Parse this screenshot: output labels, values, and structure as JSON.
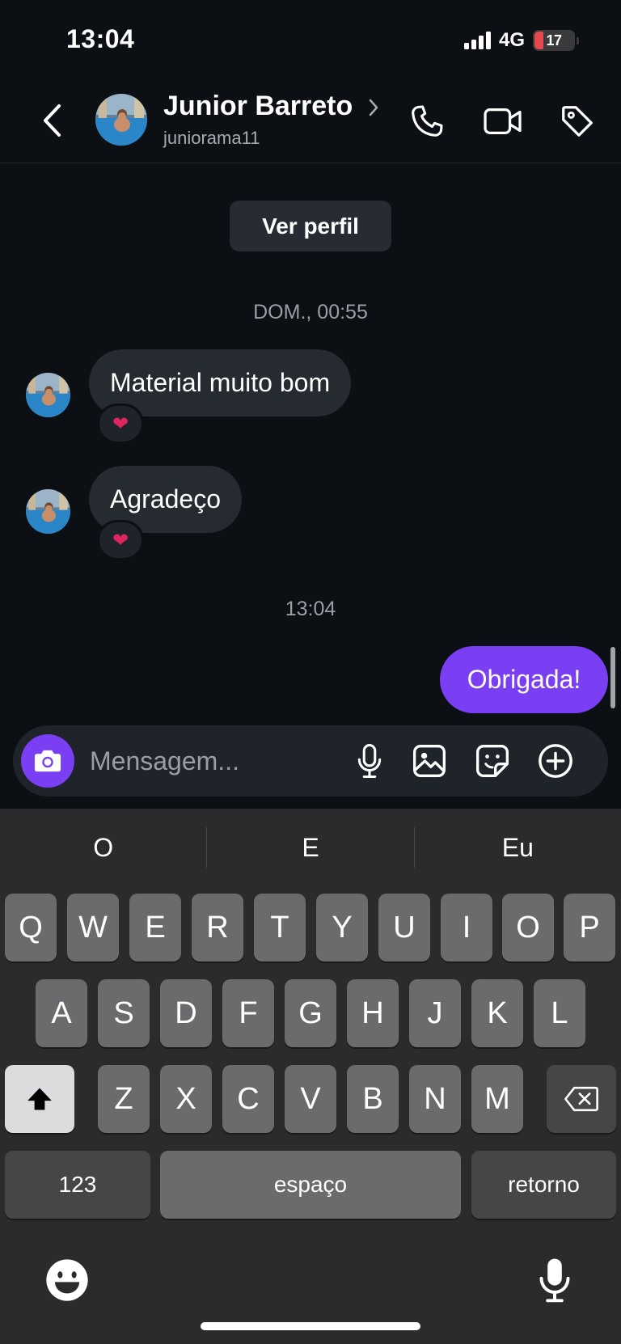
{
  "status_bar": {
    "time": "13:04",
    "network": "4G",
    "battery": "17"
  },
  "header": {
    "name": "Junior Barreto",
    "username": "juniorama11"
  },
  "chat": {
    "profile_button": "Ver perfil",
    "timestamp_1": "DOM., 00:55",
    "messages_in": [
      {
        "text": "Material muito bom",
        "reaction": "❤"
      },
      {
        "text": "Agradeço",
        "reaction": "❤"
      }
    ],
    "timestamp_2": "13:04",
    "message_out": "Obrigada!"
  },
  "composer": {
    "placeholder": "Mensagem..."
  },
  "keyboard": {
    "suggestions": [
      "O",
      "E",
      "Eu"
    ],
    "row1": [
      "Q",
      "W",
      "E",
      "R",
      "T",
      "Y",
      "U",
      "I",
      "O",
      "P"
    ],
    "row2": [
      "A",
      "S",
      "D",
      "F",
      "G",
      "H",
      "J",
      "K",
      "L"
    ],
    "row3": [
      "Z",
      "X",
      "C",
      "V",
      "B",
      "N",
      "M"
    ],
    "numbers_label": "123",
    "space_label": "espaço",
    "return_label": "retorno"
  },
  "colors": {
    "accent": "#7a3ff2",
    "background": "#0c0f14",
    "bubble_in": "#262a31",
    "heart": "#e0245e"
  },
  "icons": [
    "back-icon",
    "chevron-right-icon",
    "phone-icon",
    "video-icon",
    "tag-icon",
    "camera-icon",
    "mic-icon",
    "gallery-icon",
    "sticker-icon",
    "plus-icon",
    "shift-icon",
    "backspace-icon",
    "emoji-icon",
    "dictation-icon"
  ]
}
